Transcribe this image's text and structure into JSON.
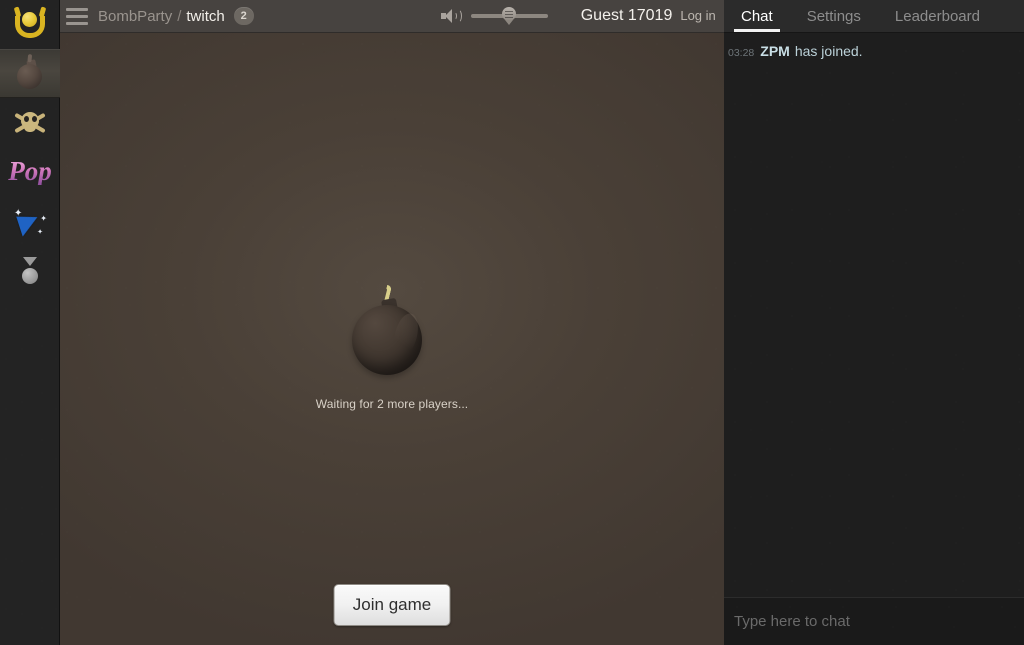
{
  "sidebar": {
    "items": [
      {
        "name": "catch-game-icon",
        "label": "Catch"
      },
      {
        "name": "bombparty-game-icon",
        "label": "BombParty",
        "active": true
      },
      {
        "name": "skull-game-icon",
        "label": "Skull"
      },
      {
        "name": "pop-game-icon",
        "label": "Pop"
      },
      {
        "name": "arrow-game-icon",
        "label": "Arrow"
      },
      {
        "name": "medal-icon",
        "label": "Medal"
      }
    ]
  },
  "topbar": {
    "menu_icon": "hamburger-icon",
    "app_name": "BombParty",
    "separator": "/",
    "room_name": "twitch",
    "room_badge": "2",
    "volume_icon": "speaker-icon",
    "volume_value": 40,
    "guest_name": "Guest 17019",
    "login_label": "Log in"
  },
  "game": {
    "bomb_icon": "bomb-icon",
    "status_text": "Waiting for 2 more players...",
    "join_label": "Join game"
  },
  "chat": {
    "tabs": [
      {
        "label": "Chat",
        "active": true
      },
      {
        "label": "Settings",
        "active": false
      },
      {
        "label": "Leaderboard",
        "active": false
      }
    ],
    "messages": [
      {
        "time": "03:28",
        "user": "ZPM",
        "text": "has joined."
      }
    ],
    "input_value": "",
    "input_placeholder": "Type here to chat"
  },
  "colors": {
    "game_bg": "#4a4037",
    "topbar_bg": "#474340",
    "sidebar_bg": "#232323",
    "chat_bg": "#1e1e1e",
    "accent_gold": "#d9b421",
    "accent_blue": "#1f63c4",
    "accent_pink": "#d278bd"
  }
}
